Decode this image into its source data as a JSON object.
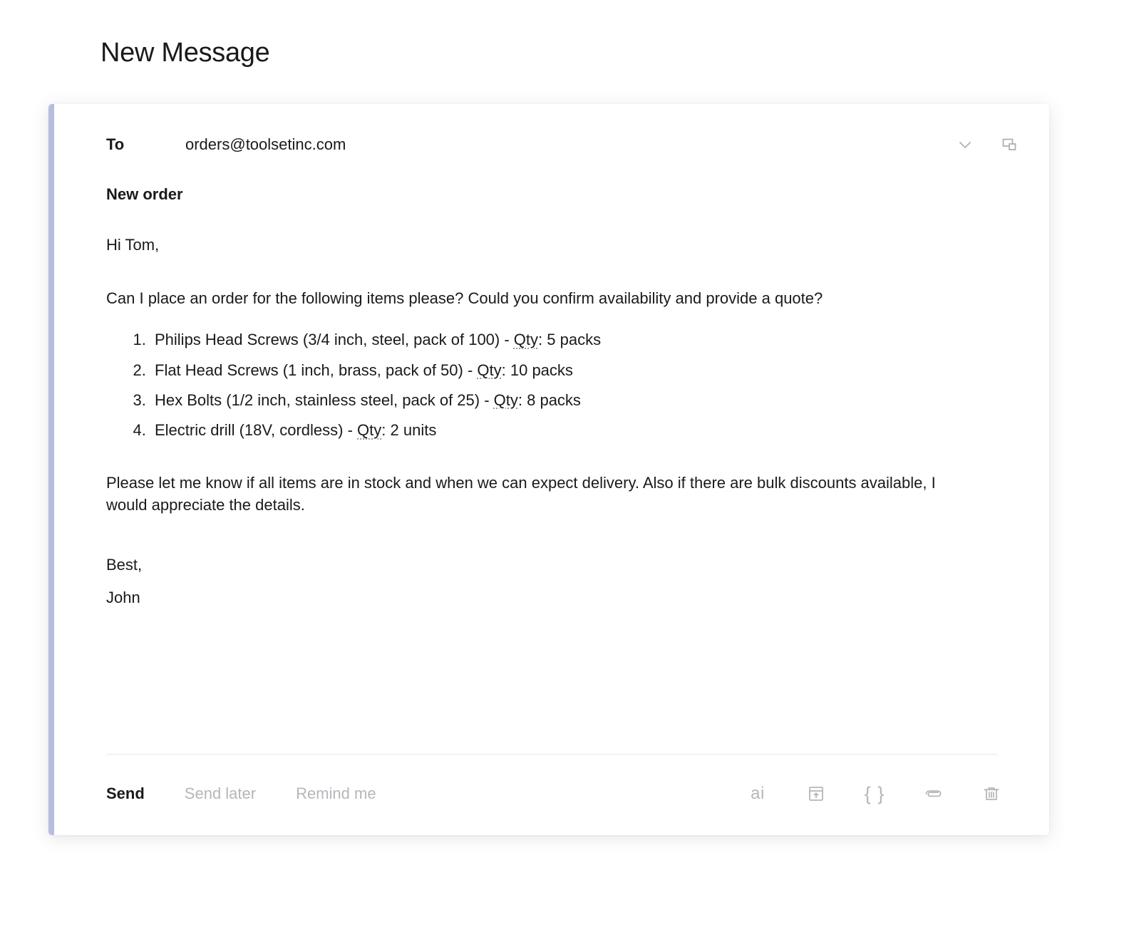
{
  "window": {
    "title": "New Message",
    "accent_color": "#b8bce0",
    "background_color": "#ffffff",
    "card_background": "#ffffff"
  },
  "header": {
    "to_label": "To",
    "to_value": "orders@toolsetinc.com",
    "icons": [
      {
        "name": "chevron-down-icon",
        "title": "Expand recipients"
      },
      {
        "name": "popout-window-icon",
        "title": "Pop out message"
      }
    ]
  },
  "message": {
    "subject": "New order",
    "greeting": "Hi Tom,",
    "paragraph_1": "Can I place an order for the following items please? Could you confirm availability and provide a quote?",
    "items": [
      {
        "text": "Philips Head Screws (3/4 inch, steel, pack of 100) - ",
        "qty_label": "Qty",
        "qty_value": ": 5 packs"
      },
      {
        "text": "Flat Head Screws (1 inch, brass, pack of 50) - ",
        "qty_label": "Qty",
        "qty_value": ": 10 packs"
      },
      {
        "text": "Hex Bolts (1/2 inch, stainless steel, pack of 25) - ",
        "qty_label": "Qty",
        "qty_value": ": 8 packs"
      },
      {
        "text": "Electric drill (18V, cordless) - ",
        "qty_label": "Qty",
        "qty_value": ": 2 units"
      }
    ],
    "paragraph_2": "Please let me know if all items are in stock and when we can expect delivery. Also if there are bulk discounts available, I would appreciate the details.",
    "sign_off": "Best,",
    "sender_name": "John"
  },
  "footer": {
    "send_label": "Send",
    "send_later_label": "Send later",
    "remind_me_label": "Remind me",
    "ai_label": "ai",
    "braces_label": "{ }",
    "icons": [
      {
        "name": "ai-icon",
        "title": "AI assist"
      },
      {
        "name": "insert-template-icon",
        "title": "Insert template"
      },
      {
        "name": "variables-icon",
        "title": "Insert variable"
      },
      {
        "name": "attachment-icon",
        "title": "Attach file"
      },
      {
        "name": "trash-icon",
        "title": "Discard draft"
      }
    ],
    "muted_color": "#b6b6bb",
    "active_color": "#1a1a1a"
  }
}
